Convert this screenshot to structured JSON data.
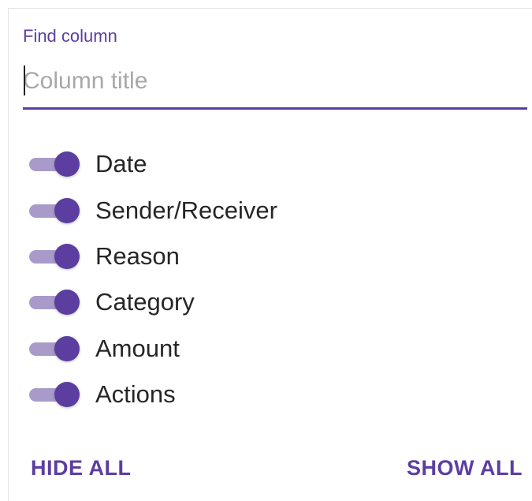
{
  "search": {
    "label": "Find column",
    "placeholder": "Column title",
    "value": ""
  },
  "colors": {
    "accent": "#5c3ea1",
    "track": "#a99bc9"
  },
  "columns": [
    {
      "label": "Date",
      "enabled": true
    },
    {
      "label": "Sender/Receiver",
      "enabled": true
    },
    {
      "label": "Reason",
      "enabled": true
    },
    {
      "label": "Category",
      "enabled": true
    },
    {
      "label": "Amount",
      "enabled": true
    },
    {
      "label": "Actions",
      "enabled": true
    }
  ],
  "actions": {
    "hide_all": "HIDE ALL",
    "show_all": "SHOW ALL"
  }
}
